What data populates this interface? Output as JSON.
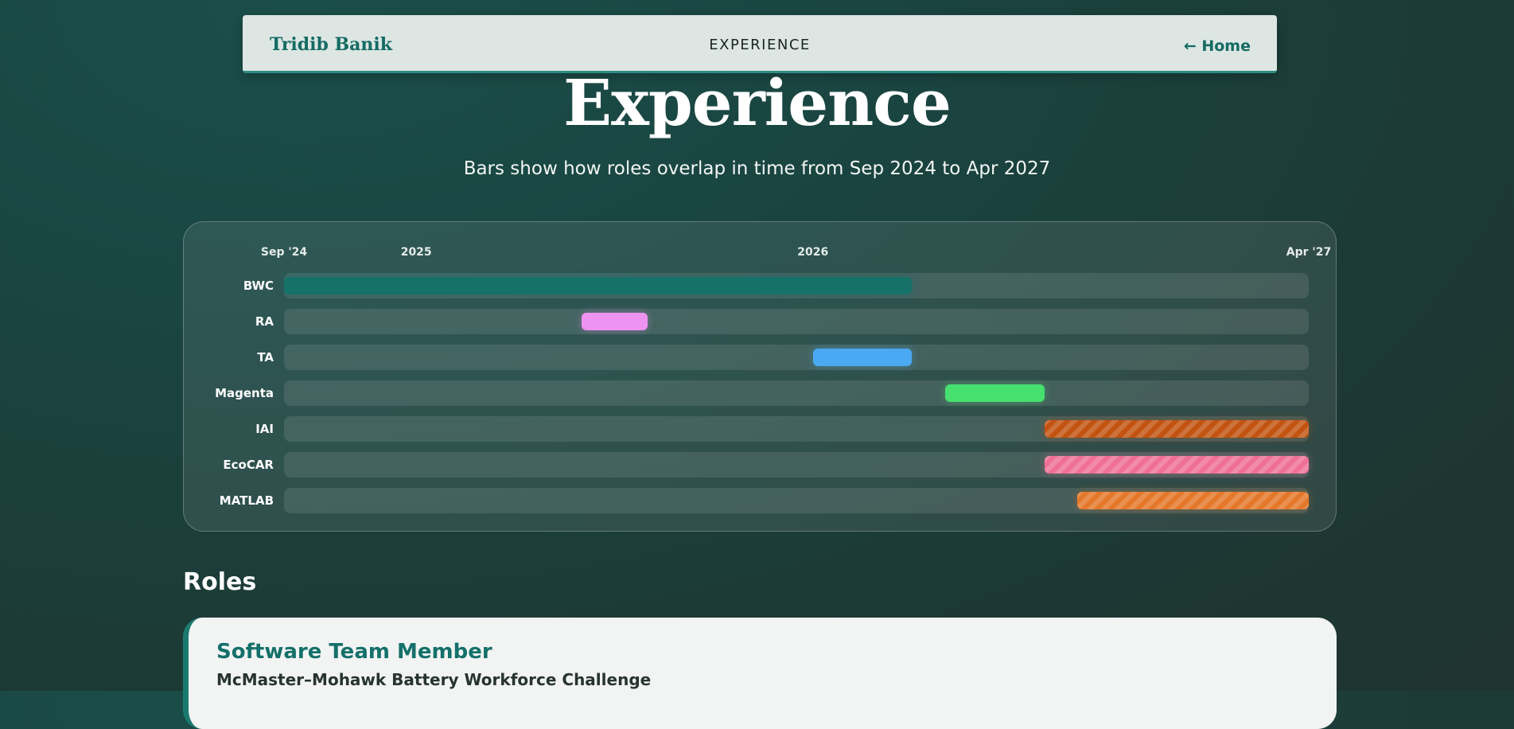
{
  "nav": {
    "brand": "Tridib Banik",
    "title": "EXPERIENCE",
    "home_link": "← Home"
  },
  "header": {
    "title": "Experience",
    "subtitle": "Bars show how roles overlap in time from Sep 2024 to Apr 2027"
  },
  "chart_data": {
    "type": "gantt",
    "x_range": [
      "2024-09",
      "2027-04"
    ],
    "ticks": [
      {
        "label": "Sep '24",
        "date": "2024-09"
      },
      {
        "label": "2025",
        "date": "2025-01"
      },
      {
        "label": "2026",
        "date": "2026-01"
      },
      {
        "label": "Apr '27",
        "date": "2027-04"
      }
    ],
    "rows": [
      {
        "label": "BWC",
        "start": "2024-09",
        "end": "2026-04",
        "color": "#167168",
        "striped": false
      },
      {
        "label": "RA",
        "start": "2025-06",
        "end": "2025-08",
        "color": "#ee93f1",
        "striped": false
      },
      {
        "label": "TA",
        "start": "2026-01",
        "end": "2026-04",
        "color": "#4ba9f3",
        "striped": false
      },
      {
        "label": "Magenta",
        "start": "2026-05",
        "end": "2026-08",
        "color": "#46e06f",
        "striped": false
      },
      {
        "label": "IAI",
        "start": "2026-08",
        "end": "2027-04",
        "color": "#c25310",
        "striped": true
      },
      {
        "label": "EcoCAR",
        "start": "2026-08",
        "end": "2027-04",
        "color": "#ef7097",
        "striped": true
      },
      {
        "label": "MATLAB",
        "start": "2026-09",
        "end": "2027-04",
        "color": "#e4782a",
        "striped": true
      }
    ]
  },
  "roles": {
    "heading": "Roles",
    "items": [
      {
        "title": "Software Team Member",
        "org": "McMaster–Mohawk Battery Workforce Challenge"
      }
    ]
  }
}
